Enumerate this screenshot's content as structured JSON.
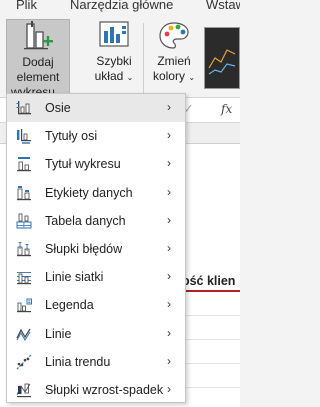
{
  "tabs": [
    "Plik",
    "Narzędzia główne",
    "Wstaw"
  ],
  "ribbon": {
    "add_element_line1": "Dodaj element",
    "add_element_line2": "wykresu",
    "quick_layout_line1": "Szybki",
    "quick_layout_line2": "układ",
    "change_colors_line1": "Zmień",
    "change_colors_line2": "kolory",
    "caret": "⌄"
  },
  "formula_bar": {
    "fx": "fx",
    "check": "✓"
  },
  "sheet": {
    "cell_text": "ilość klien"
  },
  "menu": {
    "chevron": "›",
    "items": [
      {
        "label": "Osie",
        "icon": "axes-icon"
      },
      {
        "label": "Tytuły osi",
        "icon": "axis-titles-icon"
      },
      {
        "label": "Tytuł wykresu",
        "icon": "chart-title-icon"
      },
      {
        "label": "Etykiety danych",
        "icon": "data-labels-icon"
      },
      {
        "label": "Tabela danych",
        "icon": "data-table-icon"
      },
      {
        "label": "Słupki błędów",
        "icon": "error-bars-icon"
      },
      {
        "label": "Linie siatki",
        "icon": "gridlines-icon"
      },
      {
        "label": "Legenda",
        "icon": "legend-icon"
      },
      {
        "label": "Linie",
        "icon": "lines-icon"
      },
      {
        "label": "Linia trendu",
        "icon": "trendline-icon"
      },
      {
        "label": "Słupki wzrost-spadek",
        "icon": "up-down-bars-icon"
      }
    ]
  },
  "colors": {
    "accent_red": "#b22222",
    "icon_blue": "#2e75b6",
    "menu_hover": "#e8e8e8"
  }
}
